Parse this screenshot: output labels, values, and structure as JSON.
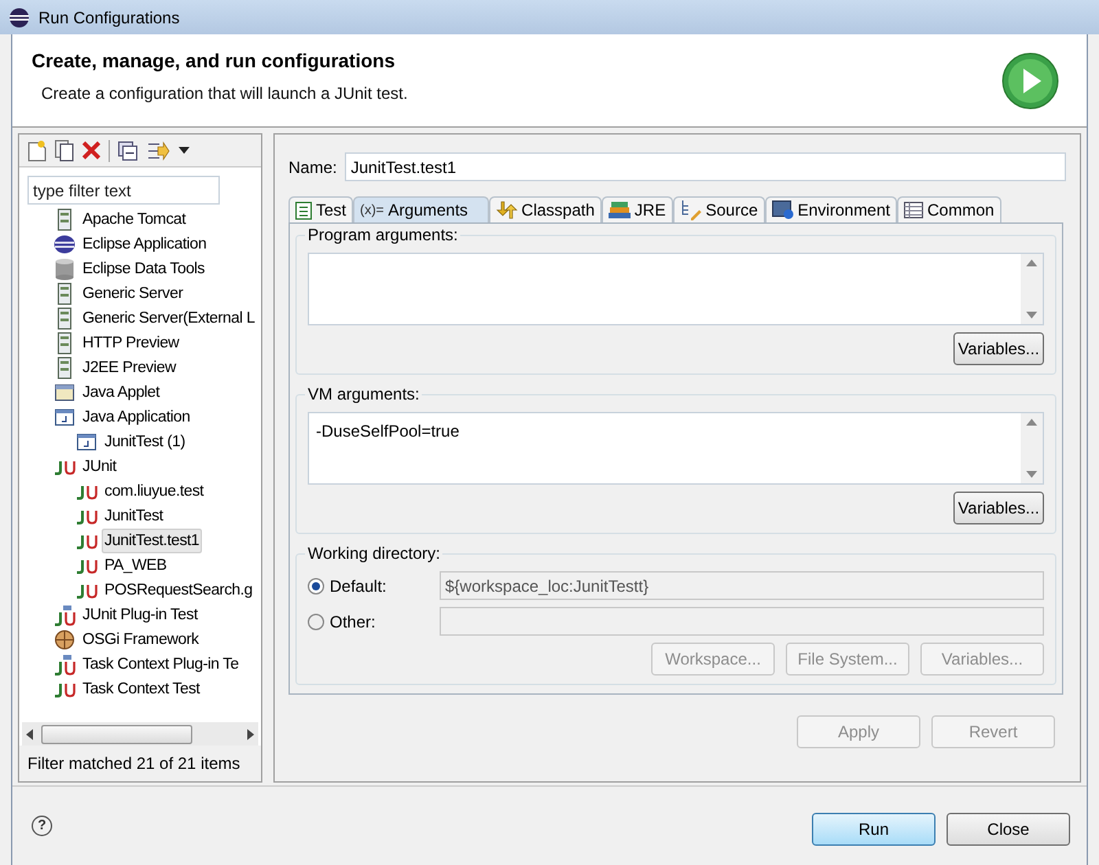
{
  "window": {
    "title": "Run Configurations"
  },
  "header": {
    "title": "Create, manage, and run configurations",
    "subtitle": "Create a configuration that will launch a JUnit test."
  },
  "sidebar": {
    "filter": {
      "placeholder": "type filter text"
    },
    "items": [
      {
        "label": "Apache Tomcat",
        "kind": "server",
        "selected": false
      },
      {
        "label": "Eclipse Application",
        "kind": "eclipse",
        "selected": false
      },
      {
        "label": "Eclipse Data Tools",
        "kind": "db",
        "selected": false
      },
      {
        "label": "Generic Server",
        "kind": "server",
        "selected": false
      },
      {
        "label": "Generic Server(External L",
        "kind": "server",
        "selected": false
      },
      {
        "label": "HTTP Preview",
        "kind": "server",
        "selected": false
      },
      {
        "label": "J2EE Preview",
        "kind": "server",
        "selected": false
      },
      {
        "label": "Java Applet",
        "kind": "applet",
        "selected": false
      },
      {
        "label": "Java Application",
        "kind": "javaapp",
        "selected": false,
        "children": [
          {
            "label": "JunitTest (1)",
            "kind": "javaapp",
            "selected": false
          }
        ]
      },
      {
        "label": "JUnit",
        "kind": "junit",
        "selected": false,
        "children": [
          {
            "label": "com.liuyue.test",
            "kind": "junit",
            "selected": false
          },
          {
            "label": "JunitTest",
            "kind": "junit",
            "selected": false
          },
          {
            "label": "JunitTest.test1",
            "kind": "junit",
            "selected": true
          },
          {
            "label": "PA_WEB",
            "kind": "junit",
            "selected": false
          },
          {
            "label": "POSRequestSearch.g",
            "kind": "junit",
            "selected": false
          }
        ]
      },
      {
        "label": "JUnit Plug-in Test",
        "kind": "junitplugin",
        "selected": false
      },
      {
        "label": "OSGi Framework",
        "kind": "osgi",
        "selected": false
      },
      {
        "label": "Task Context Plug-in Te",
        "kind": "junitplugin",
        "selected": false
      },
      {
        "label": "Task Context Test",
        "kind": "junit",
        "selected": false
      }
    ],
    "status": "Filter matched 21 of 21 items"
  },
  "name": {
    "label": "Name:",
    "value": "JunitTest.test1"
  },
  "tabs": [
    {
      "label": "Test",
      "kind": "test",
      "selected": false
    },
    {
      "label": "Arguments",
      "kind": "args",
      "icon_text": "(x)=",
      "selected": true
    },
    {
      "label": "Classpath",
      "kind": "classpath",
      "selected": false
    },
    {
      "label": "JRE",
      "kind": "jre",
      "selected": false
    },
    {
      "label": "Source",
      "kind": "source",
      "selected": false
    },
    {
      "label": "Environment",
      "kind": "env",
      "selected": false
    },
    {
      "label": "Common",
      "kind": "common",
      "selected": false
    }
  ],
  "program_arguments": {
    "label": "Program arguments:",
    "button": {
      "label": "Variables...",
      "disabled": false
    }
  },
  "vm_arguments": {
    "label": "VM arguments:",
    "value": "-DuseSelfPool=true",
    "button": {
      "label": "Variables...",
      "disabled": false
    }
  },
  "working_directory": {
    "label": "Working directory:",
    "options": [
      {
        "label": "Default:",
        "selected": true,
        "value": "${workspace_loc:JunitTestt}"
      },
      {
        "label": "Other:",
        "selected": false
      }
    ],
    "buttons": [
      {
        "label": "Workspace...",
        "disabled": true
      },
      {
        "label": "File System...",
        "disabled": true
      },
      {
        "label": "Variables...",
        "disabled": true
      }
    ]
  },
  "actions": [
    {
      "label": "Apply",
      "disabled": true
    },
    {
      "label": "Revert",
      "disabled": true
    }
  ],
  "footer": {
    "help": "?",
    "buttons": [
      {
        "label": "Run",
        "default": true
      },
      {
        "label": "Close",
        "default": false
      }
    ]
  }
}
